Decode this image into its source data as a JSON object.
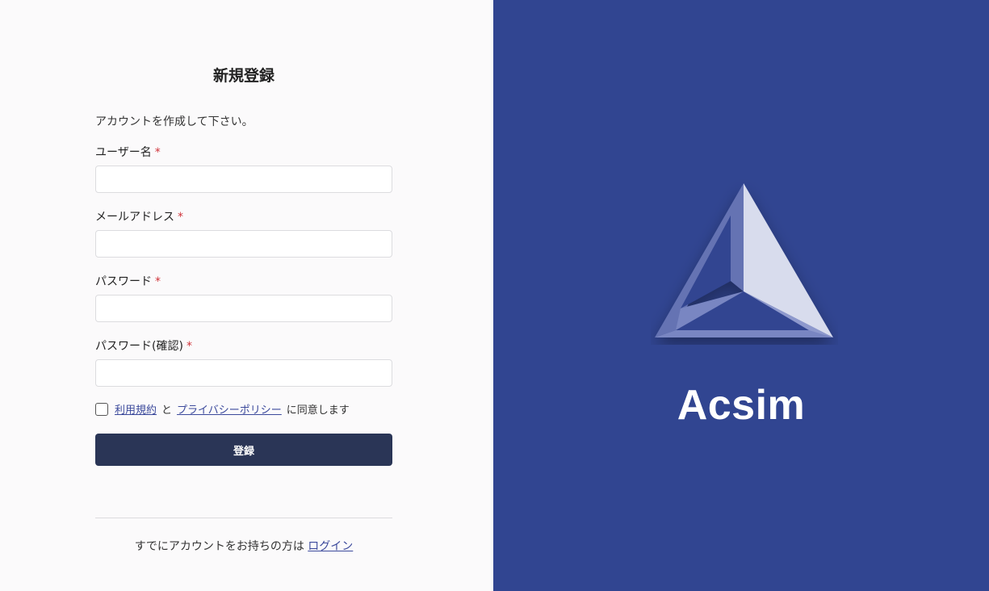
{
  "form": {
    "title": "新規登録",
    "intro": "アカウントを作成して下さい。",
    "required_mark": "*",
    "fields": [
      {
        "label": "ユーザー名",
        "value": "",
        "placeholder": ""
      },
      {
        "label": "メールアドレス",
        "value": "",
        "placeholder": ""
      },
      {
        "label": "パスワード",
        "value": "",
        "placeholder": ""
      },
      {
        "label": "パスワード(確認)",
        "value": "",
        "placeholder": ""
      }
    ],
    "agree": {
      "terms_link": "利用規約",
      "and": "と",
      "privacy_link": "プライバシーポリシー",
      "suffix": "に同意します",
      "checked": false
    },
    "submit_label": "登録",
    "footer_text": "すでにアカウントをお持ちの方は",
    "login_link": "ログイン"
  },
  "brand": {
    "name": "Acsim",
    "logo_icon": "triangle-logo-icon"
  },
  "colors": {
    "brand_panel": "#314591",
    "submit_button": "#2a3556",
    "link": "#3c4a9c",
    "required": "#d0343b"
  }
}
